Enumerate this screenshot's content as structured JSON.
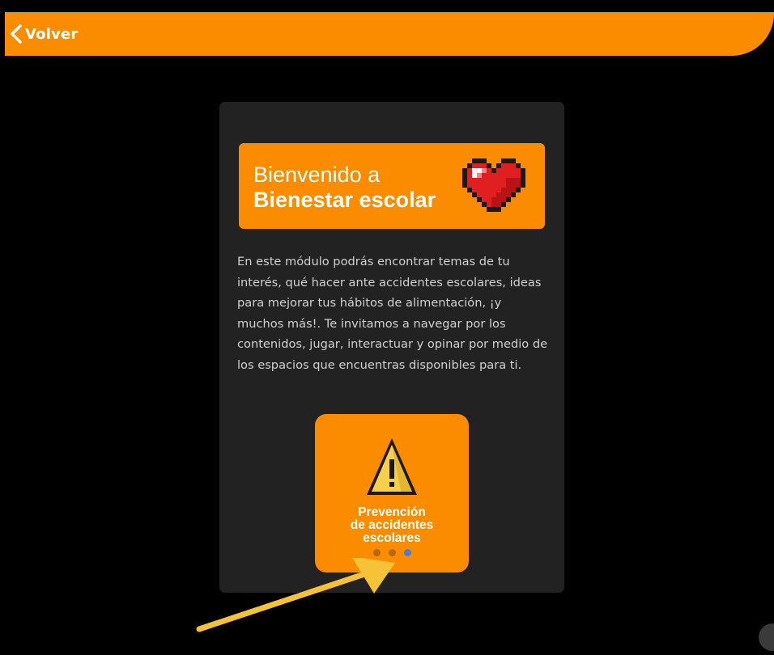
{
  "header": {
    "back_label": "Volver",
    "back_icon": "chevron-left-icon"
  },
  "colors": {
    "accent": "#fb8c00",
    "background": "#000000",
    "card": "#222222",
    "annotation_arrow": "#f6c338",
    "active_dot": "#4a7bdc"
  },
  "welcome": {
    "line1": "Bienvenido a",
    "line2": "Bienestar escolar",
    "icon": "pixel-heart-icon",
    "intro": "En este módulo podrás encontrar temas de tu interés, qué hacer ante accidentes escolares, ideas para mejorar tus hábitos de alimentación, ¡y muchos más!. Te invitamos a navegar por los contenidos, jugar, interactuar y opinar por medio de los espacios que encuentras disponibles para ti."
  },
  "carousel": {
    "current_tile": {
      "icon": "warning-icon",
      "label": "Prevención\nde accidentes\nescolares"
    },
    "pages_total": 3,
    "active_index": 2
  }
}
